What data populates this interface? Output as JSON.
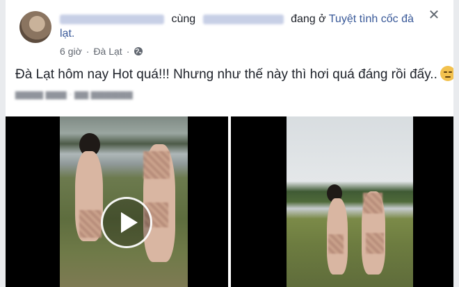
{
  "header": {
    "connector_with": "cùng",
    "connector_at": "đang ở",
    "place": "Tuyệt tình cốc đà lạt.",
    "close_glyph": "✕"
  },
  "meta": {
    "time": "6 giờ",
    "separator": "·",
    "location": "Đà Lạt",
    "privacy_icon": "globe-icon"
  },
  "post": {
    "text": "Đà Lạt hôm nay Hot quá!!! Nhưng như thế này thì hơi quá đáng rồi đấy..",
    "emoji": "unamused-face-emoji"
  },
  "colors": {
    "link": "#385898",
    "text": "#1d2129",
    "meta": "#616770",
    "background": "#e9ebee"
  }
}
